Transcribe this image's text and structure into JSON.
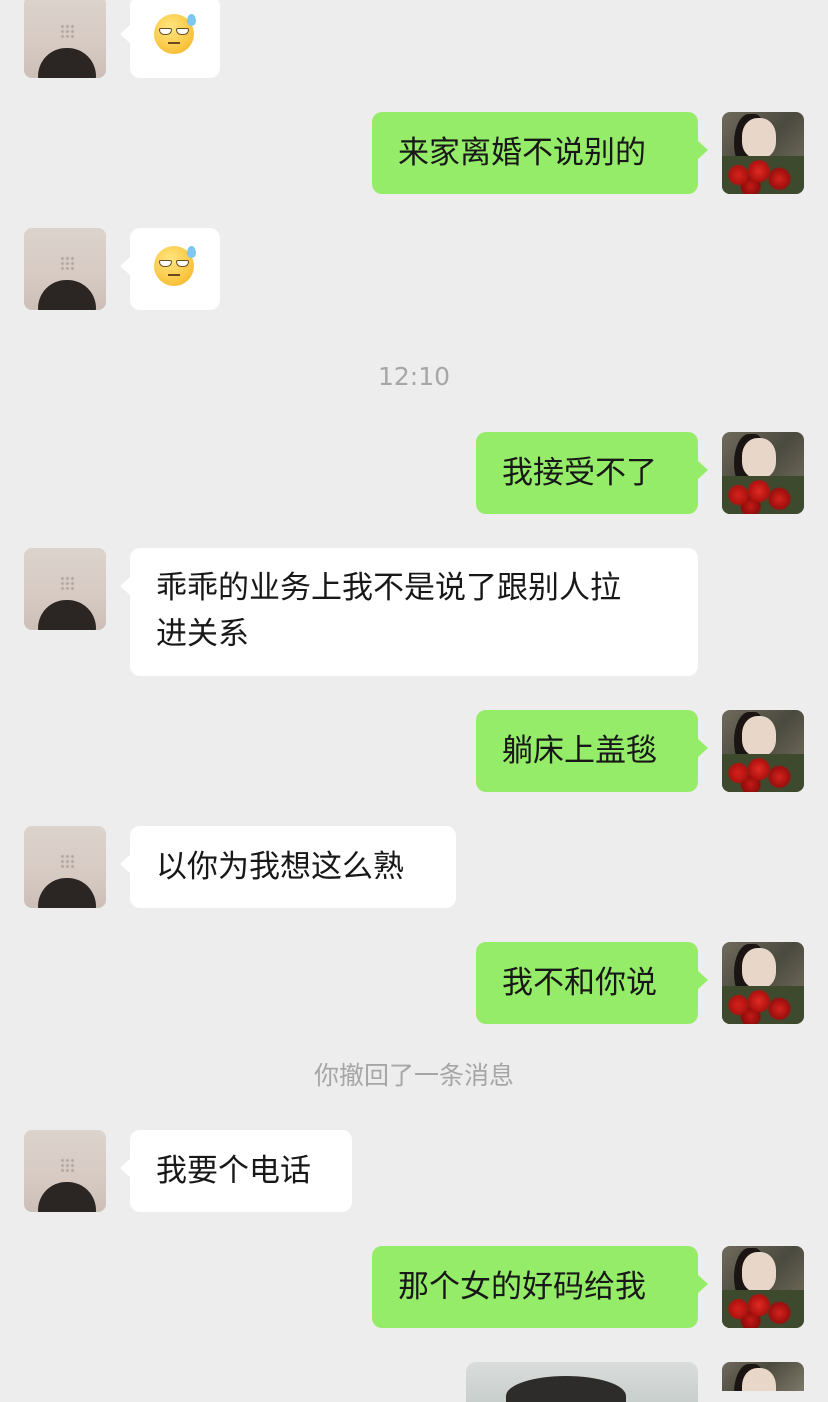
{
  "conversation": {
    "timestamp": "12:10",
    "messages": [
      {
        "sender": "other",
        "type": "emoji",
        "emoji": "sweat-smile-emoji"
      },
      {
        "sender": "self",
        "type": "text",
        "text": "来家离婚不说别的"
      },
      {
        "sender": "other",
        "type": "emoji",
        "emoji": "sweat-smile-emoji"
      },
      {
        "sender": "self",
        "type": "text",
        "text": "我接受不了"
      },
      {
        "sender": "other",
        "type": "text",
        "text_line1": "乖乖的业务上我不是说了跟别人拉",
        "text_line2": "进关系"
      },
      {
        "sender": "self",
        "type": "text",
        "text": "躺床上盖毯"
      },
      {
        "sender": "other",
        "type": "text",
        "text": "以你为我想这么熟"
      },
      {
        "sender": "self",
        "type": "text",
        "text": "我不和你说"
      },
      {
        "sender": "system",
        "type": "notice",
        "text": "你撤回了一条消息"
      },
      {
        "sender": "other",
        "type": "text",
        "text": "我要个电话"
      },
      {
        "sender": "self",
        "type": "text",
        "text": "那个女的好码给我"
      },
      {
        "sender": "self",
        "type": "image",
        "image": "photo-thumbnail"
      }
    ]
  },
  "colors": {
    "background": "#ededed",
    "self_bubble": "#95ec69",
    "other_bubble": "#ffffff",
    "system_text": "#a6a6a6"
  }
}
